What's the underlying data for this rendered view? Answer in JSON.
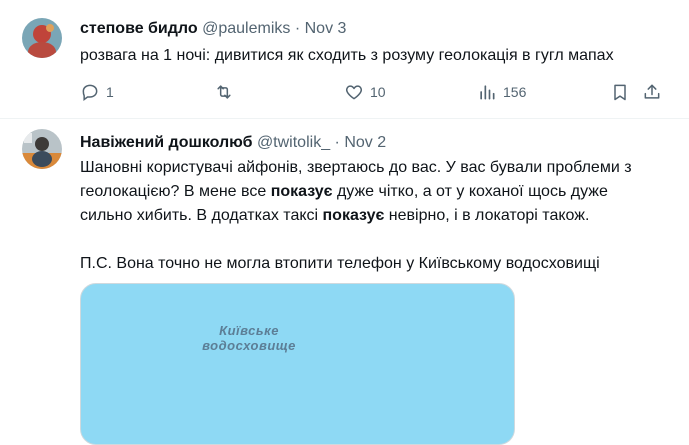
{
  "tweets": [
    {
      "name": "степове бидло",
      "handle": "@paulemiks",
      "sep": "·",
      "date": "Nov 3",
      "text": "розвага на 1 ночі: дивитися як сходить з розуму геолокація в гугл мапах",
      "actions": {
        "reply_count": "1",
        "retweet_count": "",
        "like_count": "10",
        "view_count": "156"
      }
    },
    {
      "name": "Навіжений дошколюб",
      "handle": "@twitolik_",
      "sep": "·",
      "date": "Nov 2",
      "text_parts": [
        "Шановні користувачі айфонів, звертаюсь до вас. У вас бували проблеми з геолокацією? В мене все ",
        "показує",
        " дуже чітко, а от у коханої щось дуже сильно хибить. В додатках таксі ",
        "показує",
        " невірно, і в локаторі також.",
        "П.С. Вона точно не могла втопити телефон у Київському водосховищі"
      ],
      "media": {
        "map_label": "Київське водосховище",
        "water_color": "#8ed9f4"
      }
    }
  ],
  "icons": [
    "reply-icon",
    "retweet-icon",
    "like-icon",
    "views-icon",
    "bookmark-icon",
    "share-icon"
  ],
  "colors": {
    "text": "#0f1419",
    "muted": "#536471",
    "divider": "#eff3f4"
  }
}
